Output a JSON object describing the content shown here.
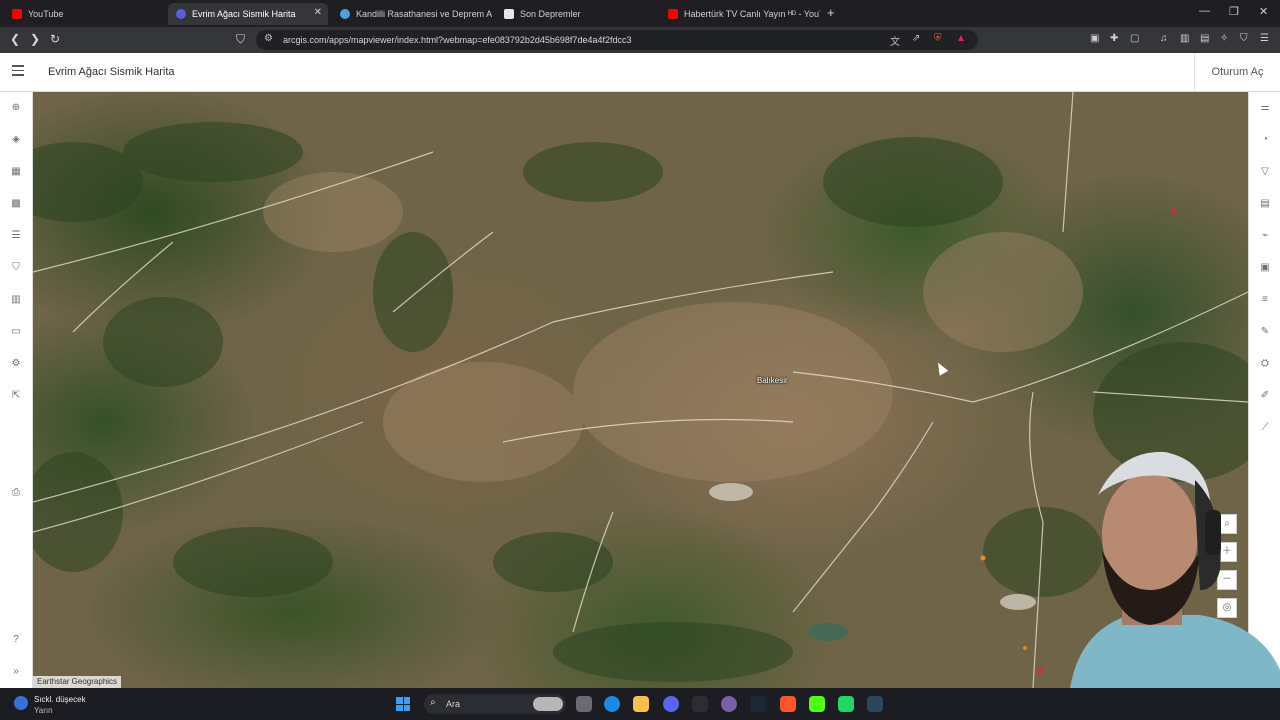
{
  "browser": {
    "tabs": [
      {
        "title": "YouTube",
        "active": false,
        "favicon_color": "#ff0000"
      },
      {
        "title": "Evrim Ağacı Sismik Harita",
        "active": true,
        "favicon_color": "#5a5fd8"
      },
      {
        "title": "Kandilli Rasathanesi ve Deprem Araşt",
        "active": false,
        "favicon_color": "#4aa3df"
      },
      {
        "title": "Son Depremler",
        "active": false,
        "favicon_color": "#e6e6e6"
      },
      {
        "title": "Habertürk TV Canlı Yayın ᴴᴰ - YouTub",
        "active": false,
        "favicon_color": "#ff0000"
      }
    ],
    "new_tab": "+",
    "url": "arcgis.com/apps/mapviewer/index.html?webmap=efe083792b2d45b698f7de4a4f2fdcc3",
    "window_controls": {
      "minimize": "—",
      "maximize": "❐",
      "close": "✕"
    }
  },
  "app": {
    "title": "Evrim Ağacı Sismik Harita",
    "sign_in": "Oturum Aç"
  },
  "left_toolbar": {
    "icons": [
      "add-icon",
      "layers-icon",
      "table-icon",
      "basemap-icon",
      "legend-icon",
      "bookmark-icon",
      "chart-icon",
      "properties-icon",
      "settings-icon",
      "share-icon",
      "print-icon",
      "help-icon",
      "expand-icon"
    ]
  },
  "right_toolbar": {
    "icons": [
      "filter-sliders-icon",
      "styles-icon",
      "filter-icon",
      "effects-icon",
      "pop-up-icon",
      "fields-icon",
      "labels-icon",
      "edit-icon",
      "analysis-icon",
      "sketch-icon",
      "measure-icon"
    ]
  },
  "map": {
    "city_label": "Balıkesir",
    "attribution": "Earthstar Geographics",
    "controls": [
      "search-icon",
      "zoom-in-icon",
      "zoom-out-icon",
      "locate-icon"
    ]
  },
  "taskbar": {
    "weather_line1": "Sıckl. düşecek",
    "weather_line2": "Yarın",
    "search_label": "Ara"
  },
  "colors": {
    "app_header_bg": "#ffffff",
    "browser_chrome": "#35363a",
    "taskbar_bg": "#1c1d22",
    "map_base": "#6f6447",
    "accent": "#0079c1"
  }
}
